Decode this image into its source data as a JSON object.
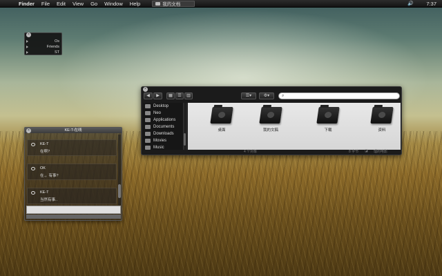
{
  "menubar": {
    "apple_icon": "apple-logo-icon",
    "items": [
      "Finder",
      "File",
      "Edit",
      "View",
      "Go",
      "Window",
      "Help"
    ],
    "doc_tab": "我的文档",
    "clock": "7:37",
    "volume_icon": "speaker-icon"
  },
  "mini_panel": {
    "rows": [
      "Os",
      "Friends",
      "ST"
    ]
  },
  "finder": {
    "toolbar": {
      "back": "◀",
      "forward": "▶",
      "search_placeholder": ""
    },
    "sidebar": [
      "Desktop",
      "Neo",
      "Applications",
      "Documents",
      "Downloads",
      "Movies",
      "Music"
    ],
    "items": [
      {
        "label": "桌面",
        "icon": "desktop-folder-icon"
      },
      {
        "label": "我的文稿",
        "icon": "documents-folder-icon"
      },
      {
        "label": "下载",
        "icon": "downloads-folder-icon"
      },
      {
        "label": "资料",
        "icon": "library-folder-icon"
      }
    ],
    "status": {
      "count": "4 个对象",
      "free": "8 字节",
      "cols": "理的电影"
    }
  },
  "chat": {
    "title": "KE-T-在线",
    "messages": [
      {
        "name": "KE-T",
        "text": "在啊?"
      },
      {
        "name": "OK",
        "text": "在.，有事?"
      },
      {
        "name": "KE-T",
        "text": "当然有事.."
      }
    ]
  }
}
